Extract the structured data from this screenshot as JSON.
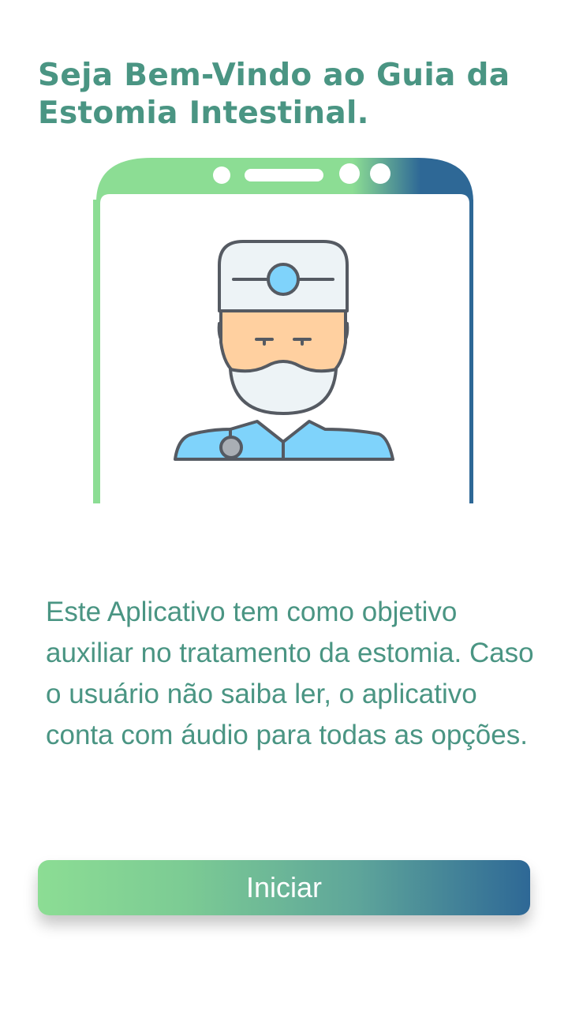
{
  "header": {
    "title": "Seja Bem-Vindo ao Guia da Estomia Intestinal."
  },
  "illustration": {
    "icon": "doctor-in-phone-illustration",
    "colors": {
      "frame_green": "#8cdd94",
      "frame_blue": "#2e6896",
      "cap": "#edf3f6",
      "head_mirror": "#7fd3fb",
      "skin": "#ffd0a0",
      "coat": "#7fd3fb",
      "outline": "#555a62"
    }
  },
  "main": {
    "description": "Este Aplicativo tem como objetivo auxiliar no tratamento da estomia. Caso o usuário não saiba ler, o aplicativo conta com áudio para todas as opções."
  },
  "footer": {
    "start_label": "Iniciar"
  },
  "theme": {
    "text_color": "#4a9583",
    "button_gradient": [
      "#8cdd94",
      "#2e6896"
    ]
  }
}
